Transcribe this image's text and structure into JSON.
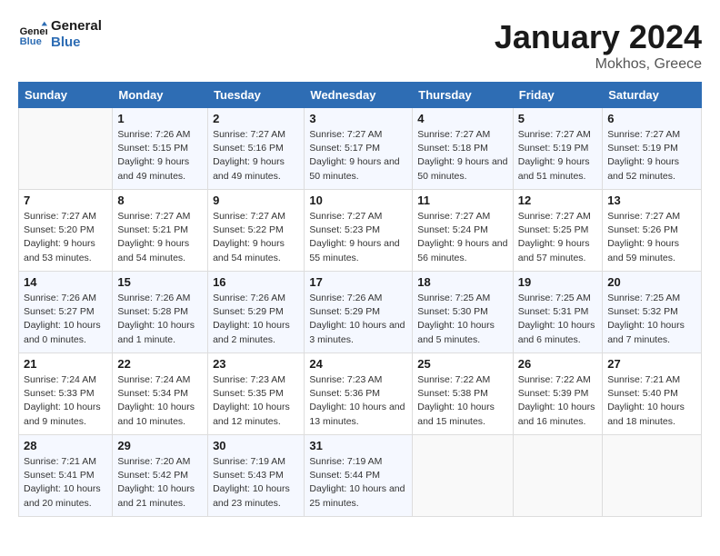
{
  "header": {
    "logo_line1": "General",
    "logo_line2": "Blue",
    "month": "January 2024",
    "location": "Mokhos, Greece"
  },
  "weekdays": [
    "Sunday",
    "Monday",
    "Tuesday",
    "Wednesday",
    "Thursday",
    "Friday",
    "Saturday"
  ],
  "weeks": [
    [
      {
        "day": "",
        "sunrise": "",
        "sunset": "",
        "daylight": ""
      },
      {
        "day": "1",
        "sunrise": "Sunrise: 7:26 AM",
        "sunset": "Sunset: 5:15 PM",
        "daylight": "Daylight: 9 hours and 49 minutes."
      },
      {
        "day": "2",
        "sunrise": "Sunrise: 7:27 AM",
        "sunset": "Sunset: 5:16 PM",
        "daylight": "Daylight: 9 hours and 49 minutes."
      },
      {
        "day": "3",
        "sunrise": "Sunrise: 7:27 AM",
        "sunset": "Sunset: 5:17 PM",
        "daylight": "Daylight: 9 hours and 50 minutes."
      },
      {
        "day": "4",
        "sunrise": "Sunrise: 7:27 AM",
        "sunset": "Sunset: 5:18 PM",
        "daylight": "Daylight: 9 hours and 50 minutes."
      },
      {
        "day": "5",
        "sunrise": "Sunrise: 7:27 AM",
        "sunset": "Sunset: 5:19 PM",
        "daylight": "Daylight: 9 hours and 51 minutes."
      },
      {
        "day": "6",
        "sunrise": "Sunrise: 7:27 AM",
        "sunset": "Sunset: 5:19 PM",
        "daylight": "Daylight: 9 hours and 52 minutes."
      }
    ],
    [
      {
        "day": "7",
        "sunrise": "Sunrise: 7:27 AM",
        "sunset": "Sunset: 5:20 PM",
        "daylight": "Daylight: 9 hours and 53 minutes."
      },
      {
        "day": "8",
        "sunrise": "Sunrise: 7:27 AM",
        "sunset": "Sunset: 5:21 PM",
        "daylight": "Daylight: 9 hours and 54 minutes."
      },
      {
        "day": "9",
        "sunrise": "Sunrise: 7:27 AM",
        "sunset": "Sunset: 5:22 PM",
        "daylight": "Daylight: 9 hours and 54 minutes."
      },
      {
        "day": "10",
        "sunrise": "Sunrise: 7:27 AM",
        "sunset": "Sunset: 5:23 PM",
        "daylight": "Daylight: 9 hours and 55 minutes."
      },
      {
        "day": "11",
        "sunrise": "Sunrise: 7:27 AM",
        "sunset": "Sunset: 5:24 PM",
        "daylight": "Daylight: 9 hours and 56 minutes."
      },
      {
        "day": "12",
        "sunrise": "Sunrise: 7:27 AM",
        "sunset": "Sunset: 5:25 PM",
        "daylight": "Daylight: 9 hours and 57 minutes."
      },
      {
        "day": "13",
        "sunrise": "Sunrise: 7:27 AM",
        "sunset": "Sunset: 5:26 PM",
        "daylight": "Daylight: 9 hours and 59 minutes."
      }
    ],
    [
      {
        "day": "14",
        "sunrise": "Sunrise: 7:26 AM",
        "sunset": "Sunset: 5:27 PM",
        "daylight": "Daylight: 10 hours and 0 minutes."
      },
      {
        "day": "15",
        "sunrise": "Sunrise: 7:26 AM",
        "sunset": "Sunset: 5:28 PM",
        "daylight": "Daylight: 10 hours and 1 minute."
      },
      {
        "day": "16",
        "sunrise": "Sunrise: 7:26 AM",
        "sunset": "Sunset: 5:29 PM",
        "daylight": "Daylight: 10 hours and 2 minutes."
      },
      {
        "day": "17",
        "sunrise": "Sunrise: 7:26 AM",
        "sunset": "Sunset: 5:29 PM",
        "daylight": "Daylight: 10 hours and 3 minutes."
      },
      {
        "day": "18",
        "sunrise": "Sunrise: 7:25 AM",
        "sunset": "Sunset: 5:30 PM",
        "daylight": "Daylight: 10 hours and 5 minutes."
      },
      {
        "day": "19",
        "sunrise": "Sunrise: 7:25 AM",
        "sunset": "Sunset: 5:31 PM",
        "daylight": "Daylight: 10 hours and 6 minutes."
      },
      {
        "day": "20",
        "sunrise": "Sunrise: 7:25 AM",
        "sunset": "Sunset: 5:32 PM",
        "daylight": "Daylight: 10 hours and 7 minutes."
      }
    ],
    [
      {
        "day": "21",
        "sunrise": "Sunrise: 7:24 AM",
        "sunset": "Sunset: 5:33 PM",
        "daylight": "Daylight: 10 hours and 9 minutes."
      },
      {
        "day": "22",
        "sunrise": "Sunrise: 7:24 AM",
        "sunset": "Sunset: 5:34 PM",
        "daylight": "Daylight: 10 hours and 10 minutes."
      },
      {
        "day": "23",
        "sunrise": "Sunrise: 7:23 AM",
        "sunset": "Sunset: 5:35 PM",
        "daylight": "Daylight: 10 hours and 12 minutes."
      },
      {
        "day": "24",
        "sunrise": "Sunrise: 7:23 AM",
        "sunset": "Sunset: 5:36 PM",
        "daylight": "Daylight: 10 hours and 13 minutes."
      },
      {
        "day": "25",
        "sunrise": "Sunrise: 7:22 AM",
        "sunset": "Sunset: 5:38 PM",
        "daylight": "Daylight: 10 hours and 15 minutes."
      },
      {
        "day": "26",
        "sunrise": "Sunrise: 7:22 AM",
        "sunset": "Sunset: 5:39 PM",
        "daylight": "Daylight: 10 hours and 16 minutes."
      },
      {
        "day": "27",
        "sunrise": "Sunrise: 7:21 AM",
        "sunset": "Sunset: 5:40 PM",
        "daylight": "Daylight: 10 hours and 18 minutes."
      }
    ],
    [
      {
        "day": "28",
        "sunrise": "Sunrise: 7:21 AM",
        "sunset": "Sunset: 5:41 PM",
        "daylight": "Daylight: 10 hours and 20 minutes."
      },
      {
        "day": "29",
        "sunrise": "Sunrise: 7:20 AM",
        "sunset": "Sunset: 5:42 PM",
        "daylight": "Daylight: 10 hours and 21 minutes."
      },
      {
        "day": "30",
        "sunrise": "Sunrise: 7:19 AM",
        "sunset": "Sunset: 5:43 PM",
        "daylight": "Daylight: 10 hours and 23 minutes."
      },
      {
        "day": "31",
        "sunrise": "Sunrise: 7:19 AM",
        "sunset": "Sunset: 5:44 PM",
        "daylight": "Daylight: 10 hours and 25 minutes."
      },
      {
        "day": "",
        "sunrise": "",
        "sunset": "",
        "daylight": ""
      },
      {
        "day": "",
        "sunrise": "",
        "sunset": "",
        "daylight": ""
      },
      {
        "day": "",
        "sunrise": "",
        "sunset": "",
        "daylight": ""
      }
    ]
  ]
}
